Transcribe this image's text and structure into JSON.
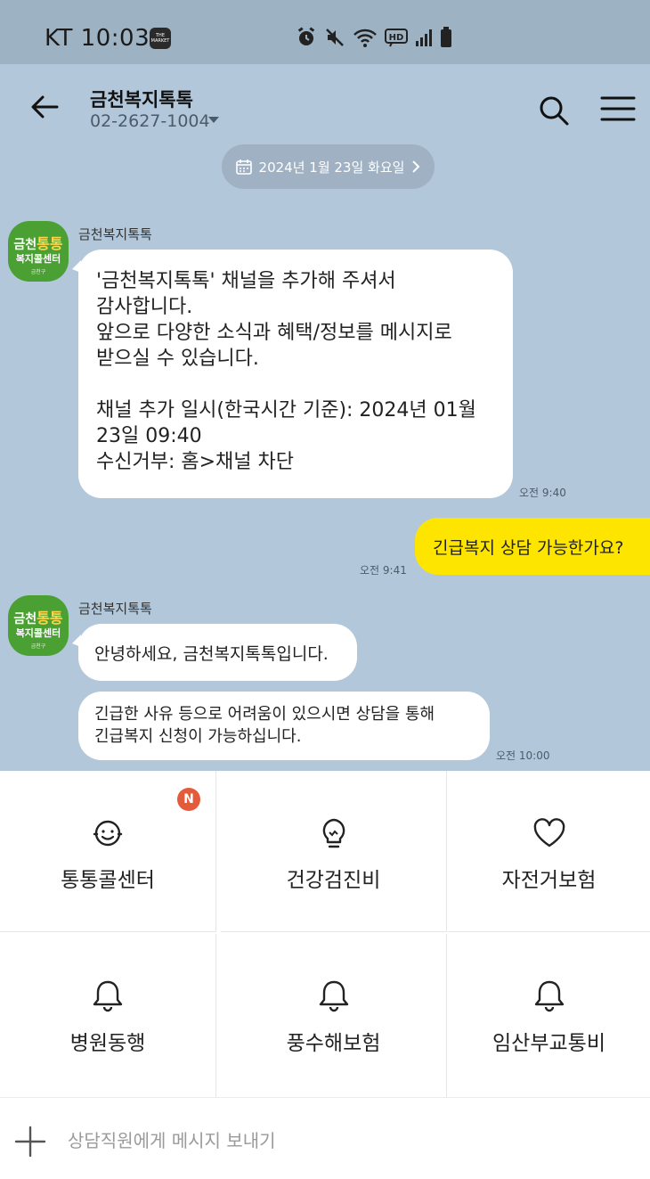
{
  "status_bar": {
    "time": "KT 10:03",
    "app_badge": "THE MARKET",
    "icons": [
      "alarm-icon",
      "mute-icon",
      "wifi-icon",
      "hd-icon",
      "signal-icon",
      "battery-icon"
    ],
    "hd_label": "HD"
  },
  "header": {
    "title": "금천복지톡톡",
    "phone": "02-2627-1004"
  },
  "date_divider": "2024년 1월 23일 화요일",
  "messages": [
    {
      "sender": "금천복지톡톡",
      "text": "'금천복지톡톡' 채널을 추가해 주셔서\n감사합니다.\n앞으로 다양한 소식과 혜택/정보를 메시지로\n받으실 수 있습니다.\n\n채널 추가 일시(한국시간 기준): 2024년 01월\n23일 09:40\n수신거부: 홈>채널 차단",
      "time": "오전 9:40"
    },
    {
      "sender": "me",
      "text": "긴급복지 상담 가능한가요?",
      "time": "오전 9:41"
    },
    {
      "sender": "금천복지톡톡",
      "text": "안녕하세요, 금천복지톡톡입니다."
    },
    {
      "text": "긴급한 사유 등으로 어려움이 있으시면 상담을 통해\n긴급복지 신청이 가능하십니다.",
      "time": "오전 10:00"
    }
  ],
  "avatar": {
    "line1_a": "금천",
    "line1_b": "통통",
    "line2": "복지콜센터",
    "line3": "금천구"
  },
  "menu": [
    {
      "label": "통통콜센터",
      "icon": "smile-face-icon",
      "badge": "N"
    },
    {
      "label": "건강검진비",
      "icon": "lightbulb-icon"
    },
    {
      "label": "자전거보험",
      "icon": "heart-icon"
    },
    {
      "label": "병원동행",
      "icon": "bell-icon"
    },
    {
      "label": "풍수해보험",
      "icon": "bell-icon"
    },
    {
      "label": "임산부교통비",
      "icon": "bell-icon"
    }
  ],
  "input": {
    "placeholder": "상담직원에게 메시지 보내기"
  },
  "colors": {
    "chat_bg": "#b2c7da",
    "my_bubble": "#fee500",
    "badge": "#e45b3c",
    "avatar_green": "#4aa033"
  }
}
